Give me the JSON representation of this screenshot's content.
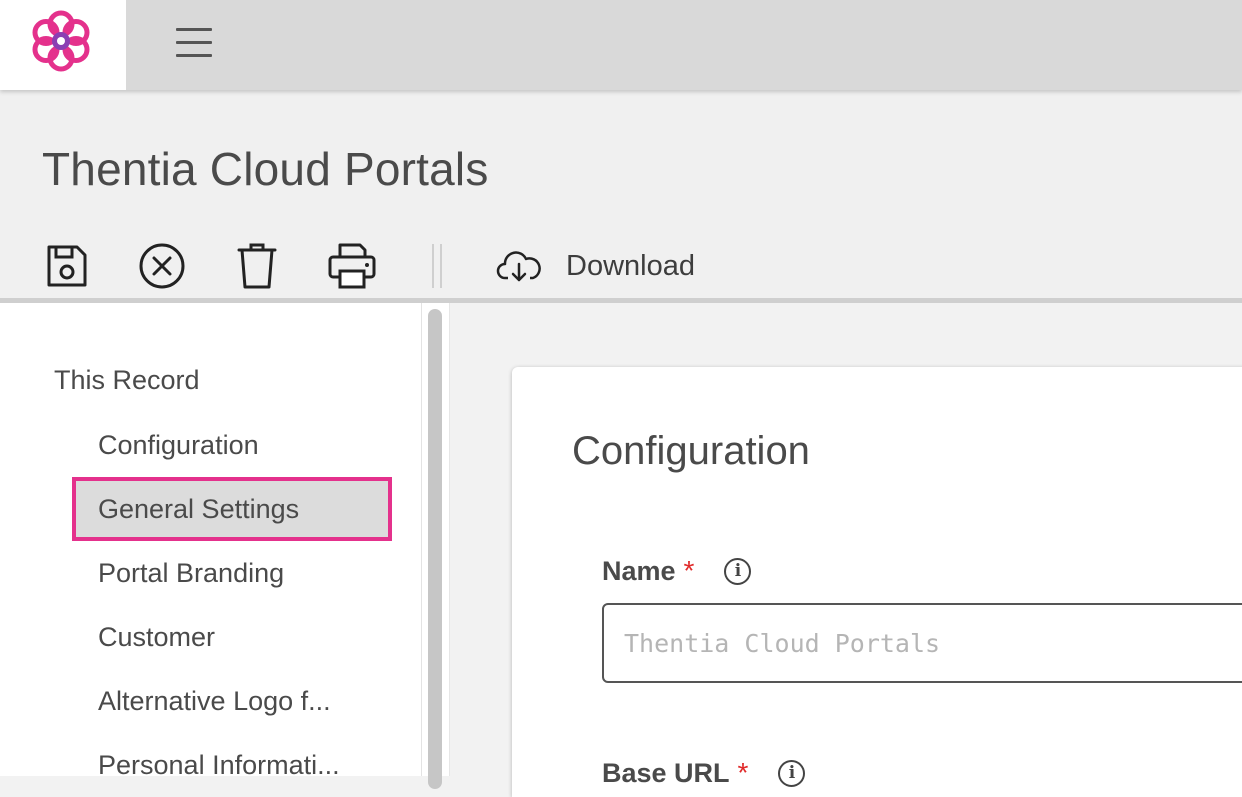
{
  "brand": {
    "accent": "#e4318c",
    "logo_icon": "flower-logo-icon"
  },
  "topbar": {
    "menu_icon": "hamburger-menu-icon"
  },
  "page": {
    "title": "Thentia Cloud Portals"
  },
  "toolbar": {
    "save_icon": "save-icon",
    "cancel_icon": "close-circle-icon",
    "delete_icon": "trash-icon",
    "print_icon": "printer-icon",
    "download_icon": "cloud-download-icon",
    "download_label": "Download"
  },
  "sidebar": {
    "heading": "This Record",
    "items": [
      {
        "label": "Configuration",
        "selected": false
      },
      {
        "label": "General Settings",
        "selected": true
      },
      {
        "label": "Portal Branding",
        "selected": false
      },
      {
        "label": "Customer",
        "selected": false
      },
      {
        "label": "Alternative Logo f...",
        "selected": false
      },
      {
        "label": "Personal Informati...",
        "selected": false
      }
    ]
  },
  "form": {
    "title": "Configuration",
    "fields": [
      {
        "label": "Name",
        "required_mark": "*",
        "info_icon": "i",
        "placeholder": "Thentia Cloud Portals",
        "value": ""
      },
      {
        "label": "Base URL",
        "required_mark": "*",
        "info_icon": "i"
      }
    ]
  }
}
